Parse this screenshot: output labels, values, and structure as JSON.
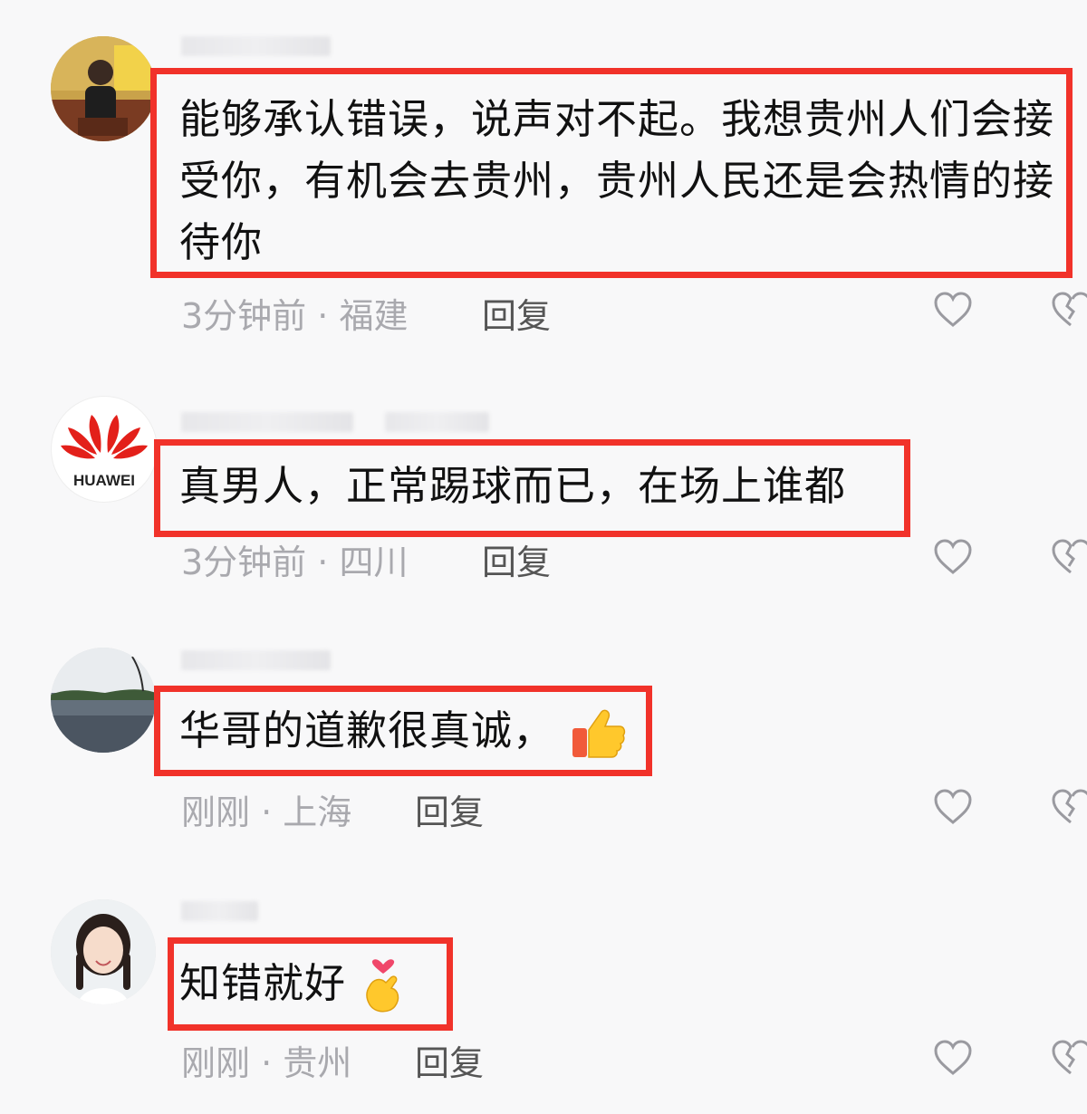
{
  "comments": [
    {
      "text": "能够承认错误，说声对不起。我想贵州人们会接受你，有机会去贵州，贵州人民还是会热情的接待你",
      "time": "3分钟前",
      "location": "福建",
      "reply_label": "回复",
      "avatar": "person-photo"
    },
    {
      "text": "真男人，正常踢球而已，在场上谁都",
      "time": "3分钟前",
      "location": "四川",
      "reply_label": "回复",
      "avatar": "huawei-logo",
      "avatar_label": "HUAWEI"
    },
    {
      "text": "华哥的道歉很真诚，",
      "emoji": "thumbs-up",
      "time": "刚刚",
      "location": "上海",
      "reply_label": "回复",
      "avatar": "lake-scene"
    },
    {
      "text": "知错就好",
      "emoji": "finger-heart",
      "time": "刚刚",
      "location": "贵州",
      "reply_label": "回复",
      "avatar": "girl-portrait"
    }
  ],
  "separator": "·",
  "colors": {
    "highlight": "#f1322a",
    "meta": "#a9a9ae",
    "text": "#111111"
  }
}
